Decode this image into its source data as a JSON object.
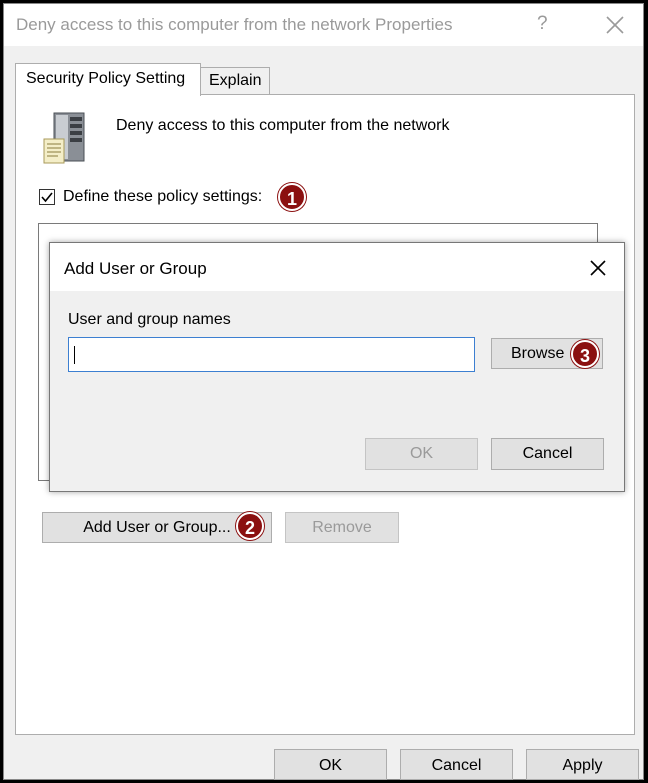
{
  "window": {
    "title": "Deny access to this computer from the network Properties",
    "help_glyph": "?",
    "close_glyph": "×"
  },
  "tabs": [
    {
      "label": "Security Policy Setting",
      "active": true
    },
    {
      "label": "Explain",
      "active": false
    }
  ],
  "policy": {
    "name": "Deny access to this computer from the network",
    "icon": "server-icon",
    "define_label": "Define these policy settings:",
    "define_checked": true
  },
  "badges": [
    "1",
    "2",
    "3"
  ],
  "panel_buttons": {
    "add": "Add User or Group...",
    "remove": "Remove"
  },
  "dialog": {
    "title": "Add User or Group",
    "field_label": "User and group names",
    "field_value": "",
    "browse": "Browse",
    "ok": "OK",
    "cancel": "Cancel"
  },
  "footer_buttons": {
    "ok": "OK",
    "cancel": "Cancel",
    "apply": "Apply"
  },
  "colors": {
    "badge": "#8b1010",
    "input_focus": "#3c7fd1"
  }
}
